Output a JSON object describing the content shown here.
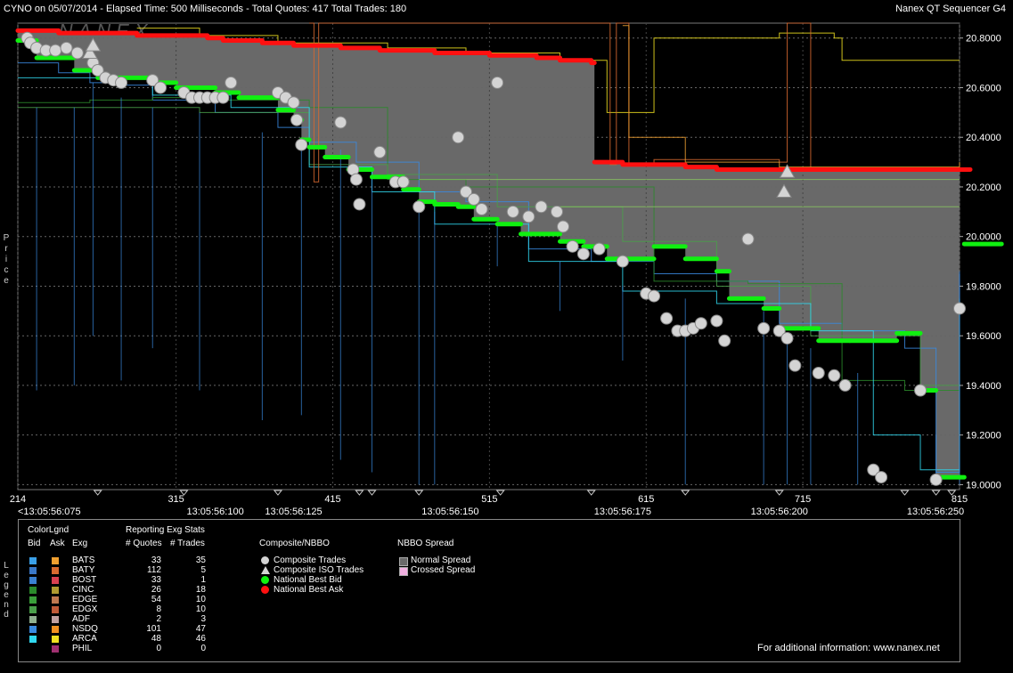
{
  "header": {
    "left": "CYNO on 05/07/2014  -  Elapsed Time: 500 Milliseconds  -  Total Quotes: 417  Total Trades: 180",
    "right": "Nanex QT Sequencer G4"
  },
  "watermark": "NANEX",
  "y_axis_side_label": "Price",
  "legend_side_label": "Legend",
  "chart_data": {
    "type": "line",
    "ylim": [
      18.98,
      20.86
    ],
    "xlim": [
      214,
      815
    ],
    "y_ticks": [
      "20.8000",
      "20.6000",
      "20.4000",
      "20.2000",
      "20.0000",
      "19.8000",
      "19.6000",
      "19.4000",
      "19.2000",
      "19.0000"
    ],
    "y_tick_values": [
      20.8,
      20.6,
      20.4,
      20.2,
      20.0,
      19.8,
      19.6,
      19.4,
      19.2,
      19.0
    ],
    "x_ticks": [
      "214",
      "315",
      "415",
      "515",
      "615",
      "715",
      "815"
    ],
    "x_tick_values": [
      214,
      315,
      415,
      515,
      615,
      715,
      815
    ],
    "time_labels": [
      "<13:05:56:075",
      "13:05:56:100",
      "13:05:56:125",
      "13:05:56:150",
      "13:05:56:175",
      "13:05:56:200",
      "13:05:56:250"
    ],
    "time_label_values": [
      214,
      340,
      390,
      490,
      600,
      700,
      845
    ],
    "national_best_ask": [
      [
        214,
        20.83
      ],
      [
        240,
        20.82
      ],
      [
        290,
        20.81
      ],
      [
        335,
        20.8
      ],
      [
        345,
        20.79
      ],
      [
        370,
        20.78
      ],
      [
        390,
        20.77
      ],
      [
        420,
        20.76
      ],
      [
        445,
        20.75
      ],
      [
        480,
        20.74
      ],
      [
        515,
        20.73
      ],
      [
        545,
        20.72
      ],
      [
        560,
        20.71
      ],
      [
        580,
        20.7
      ],
      [
        582,
        20.3
      ],
      [
        600,
        20.29
      ],
      [
        640,
        20.28
      ],
      [
        660,
        20.27
      ],
      [
        700,
        20.27
      ],
      [
        740,
        20.27
      ],
      [
        780,
        20.27
      ],
      [
        815,
        20.27
      ]
    ],
    "national_best_bid": [
      [
        214,
        20.79
      ],
      [
        226,
        20.72
      ],
      [
        250,
        20.67
      ],
      [
        265,
        20.64
      ],
      [
        300,
        20.62
      ],
      [
        315,
        20.6
      ],
      [
        340,
        20.58
      ],
      [
        355,
        20.56
      ],
      [
        380,
        20.51
      ],
      [
        390,
        20.47
      ],
      [
        395,
        20.39
      ],
      [
        400,
        20.36
      ],
      [
        410,
        20.32
      ],
      [
        425,
        20.27
      ],
      [
        440,
        20.24
      ],
      [
        460,
        20.19
      ],
      [
        470,
        20.14
      ],
      [
        480,
        20.13
      ],
      [
        495,
        20.12
      ],
      [
        505,
        20.07
      ],
      [
        520,
        20.05
      ],
      [
        535,
        20.01
      ],
      [
        560,
        19.98
      ],
      [
        575,
        19.96
      ],
      [
        590,
        19.91
      ],
      [
        620,
        19.96
      ],
      [
        640,
        19.91
      ],
      [
        660,
        19.86
      ],
      [
        668,
        19.75
      ],
      [
        690,
        19.71
      ],
      [
        700,
        19.63
      ],
      [
        710,
        19.63
      ],
      [
        725,
        19.58
      ],
      [
        745,
        19.58
      ],
      [
        760,
        19.58
      ],
      [
        775,
        19.61
      ],
      [
        790,
        19.38
      ],
      [
        800,
        19.03
      ],
      [
        815,
        19.03
      ],
      [
        818,
        19.97
      ],
      [
        835,
        19.97
      ]
    ],
    "composite_trades": [
      [
        220,
        20.8
      ],
      [
        222,
        20.78
      ],
      [
        226,
        20.76
      ],
      [
        232,
        20.75
      ],
      [
        238,
        20.75
      ],
      [
        245,
        20.76
      ],
      [
        252,
        20.74
      ],
      [
        262,
        20.7
      ],
      [
        265,
        20.67
      ],
      [
        270,
        20.64
      ],
      [
        275,
        20.63
      ],
      [
        280,
        20.62
      ],
      [
        300,
        20.63
      ],
      [
        305,
        20.6
      ],
      [
        320,
        20.58
      ],
      [
        325,
        20.56
      ],
      [
        330,
        20.56
      ],
      [
        335,
        20.56
      ],
      [
        340,
        20.56
      ],
      [
        345,
        20.56
      ],
      [
        350,
        20.62
      ],
      [
        380,
        20.58
      ],
      [
        385,
        20.56
      ],
      [
        390,
        20.54
      ],
      [
        392,
        20.47
      ],
      [
        395,
        20.37
      ],
      [
        420,
        20.46
      ],
      [
        428,
        20.27
      ],
      [
        430,
        20.23
      ],
      [
        432,
        20.13
      ],
      [
        445,
        20.34
      ],
      [
        455,
        20.22
      ],
      [
        460,
        20.22
      ],
      [
        470,
        20.12
      ],
      [
        495,
        20.4
      ],
      [
        500,
        20.18
      ],
      [
        505,
        20.15
      ],
      [
        510,
        20.11
      ],
      [
        520,
        20.62
      ],
      [
        530,
        20.1
      ],
      [
        540,
        20.08
      ],
      [
        548,
        20.12
      ],
      [
        558,
        20.1
      ],
      [
        562,
        20.04
      ],
      [
        568,
        19.96
      ],
      [
        575,
        19.93
      ],
      [
        585,
        19.95
      ],
      [
        600,
        19.9
      ],
      [
        615,
        19.77
      ],
      [
        620,
        19.76
      ],
      [
        628,
        19.67
      ],
      [
        635,
        19.62
      ],
      [
        640,
        19.62
      ],
      [
        645,
        19.63
      ],
      [
        650,
        19.65
      ],
      [
        660,
        19.66
      ],
      [
        665,
        19.58
      ],
      [
        680,
        19.99
      ],
      [
        690,
        19.63
      ],
      [
        700,
        19.62
      ],
      [
        705,
        19.59
      ],
      [
        710,
        19.48
      ],
      [
        725,
        19.45
      ],
      [
        735,
        19.44
      ],
      [
        742,
        19.4
      ],
      [
        760,
        19.06
      ],
      [
        765,
        19.03
      ],
      [
        790,
        19.38
      ],
      [
        800,
        19.02
      ],
      [
        815,
        19.71
      ]
    ],
    "composite_iso_trades": [
      [
        260,
        20.74
      ],
      [
        262,
        20.77
      ],
      [
        705,
        20.26
      ],
      [
        703,
        20.18
      ]
    ],
    "normal_spread_fill": "#696969",
    "crossed_spread_fill": "#f0b0e0"
  },
  "legend": {
    "color_legend_title": "ColorLgnd",
    "reporting_title": "Reporting Exg Stats",
    "col_bid": "Bid",
    "col_ask": "Ask",
    "col_exg": "Exg",
    "col_quotes": "# Quotes",
    "col_trades": "# Trades",
    "exchanges": [
      {
        "name": "BATS",
        "quotes": "33",
        "trades": "35",
        "bid_color": "#3aa0e8",
        "ask_color": "#f0a030"
      },
      {
        "name": "BATY",
        "quotes": "112",
        "trades": "5",
        "bid_color": "#3a78c8",
        "ask_color": "#d86a30"
      },
      {
        "name": "BOST",
        "quotes": "33",
        "trades": "1",
        "bid_color": "#3a80d0",
        "ask_color": "#d84050"
      },
      {
        "name": "CINC",
        "quotes": "26",
        "trades": "18",
        "bid_color": "#2a8a2a",
        "ask_color": "#b09a30"
      },
      {
        "name": "EDGE",
        "quotes": "54",
        "trades": "10",
        "bid_color": "#3aa03a",
        "ask_color": "#c07850"
      },
      {
        "name": "EDGX",
        "quotes": "8",
        "trades": "10",
        "bid_color": "#4aa04a",
        "ask_color": "#c05a38"
      },
      {
        "name": "ADF",
        "quotes": "2",
        "trades": "3",
        "bid_color": "#90b090",
        "ask_color": "#c0a0a0"
      },
      {
        "name": "NSDQ",
        "quotes": "101",
        "trades": "47",
        "bid_color": "#3a8ae0",
        "ask_color": "#f09020"
      },
      {
        "name": "ARCA",
        "quotes": "48",
        "trades": "46",
        "bid_color": "#30d8f0",
        "ask_color": "#f0e020"
      },
      {
        "name": "PHIL",
        "quotes": "0",
        "trades": "0",
        "bid_color": "#000000",
        "ask_color": "#a03070"
      }
    ],
    "composite_title": "Composite/NBBO",
    "composite_items": [
      "Composite Trades",
      "Composite ISO Trades",
      "National Best Bid",
      "National Best Ask"
    ],
    "spread_title": "NBBO Spread",
    "spread_items": [
      "Normal Spread",
      "Crossed Spread"
    ],
    "footer": "For additional information: www.nanex.net"
  }
}
